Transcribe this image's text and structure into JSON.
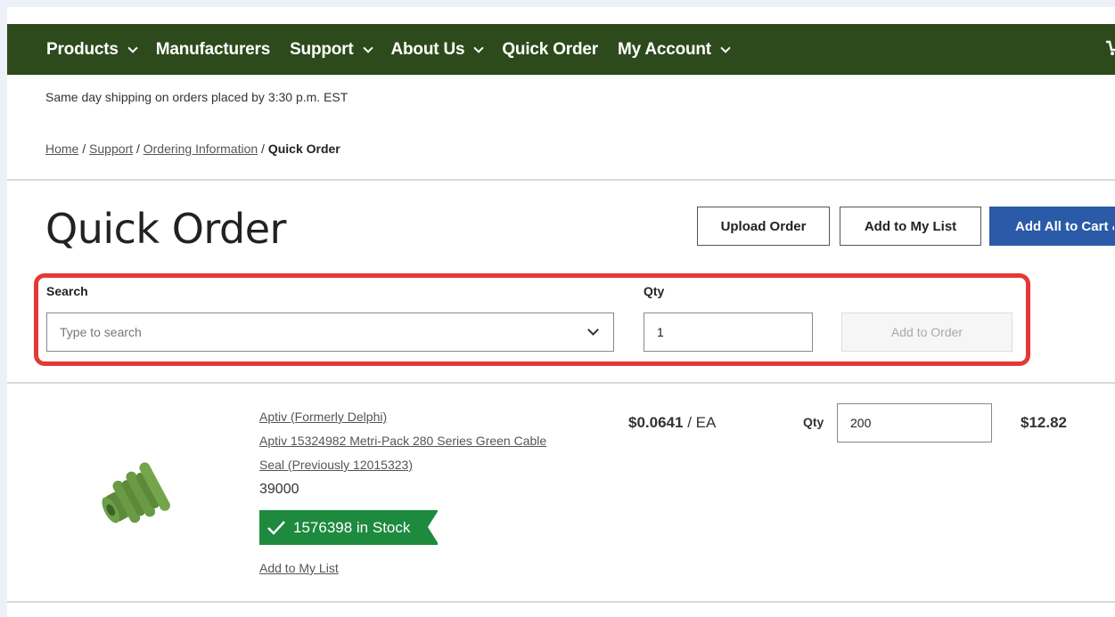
{
  "nav": {
    "items": [
      {
        "label": "Products",
        "dropdown": true
      },
      {
        "label": "Manufacturers",
        "dropdown": false
      },
      {
        "label": "Support",
        "dropdown": true
      },
      {
        "label": "About Us",
        "dropdown": true
      },
      {
        "label": "Quick Order",
        "dropdown": false
      },
      {
        "label": "My Account",
        "dropdown": true
      }
    ],
    "cart_icon": "cart-icon",
    "bg_color": "#2d4a1c"
  },
  "shipping_notice": "Same day shipping on orders placed by 3:30 p.m. EST",
  "breadcrumb": {
    "links": [
      "Home",
      "Support",
      "Ordering Information"
    ],
    "separator": "/",
    "current": "Quick Order"
  },
  "page_title": "Quick Order",
  "actions": {
    "upload": "Upload Order",
    "add_to_list": "Add to My List",
    "add_all": "Add All to Cart &"
  },
  "order_form": {
    "search_label": "Search",
    "search_placeholder": "Type to search",
    "qty_label": "Qty",
    "qty_value": "1",
    "add_button": "Add to Order"
  },
  "line_item": {
    "manufacturer": "Aptiv (Formerly Delphi)",
    "name_line1": "Aptiv 15324982 Metri-Pack 280 Series Green Cable",
    "name_line2": "Seal (Previously 12015323)",
    "part_number": "39000",
    "stock": "1576398 in Stock",
    "add_to_list": "Add to My List",
    "price": "$0.0641",
    "unit": "/ EA",
    "qty_label": "Qty",
    "qty_value": "200",
    "total": "$12.82"
  },
  "colors": {
    "primary": "#2b5aa8",
    "stock_green": "#1d8a3e",
    "highlight": "#e53935"
  }
}
